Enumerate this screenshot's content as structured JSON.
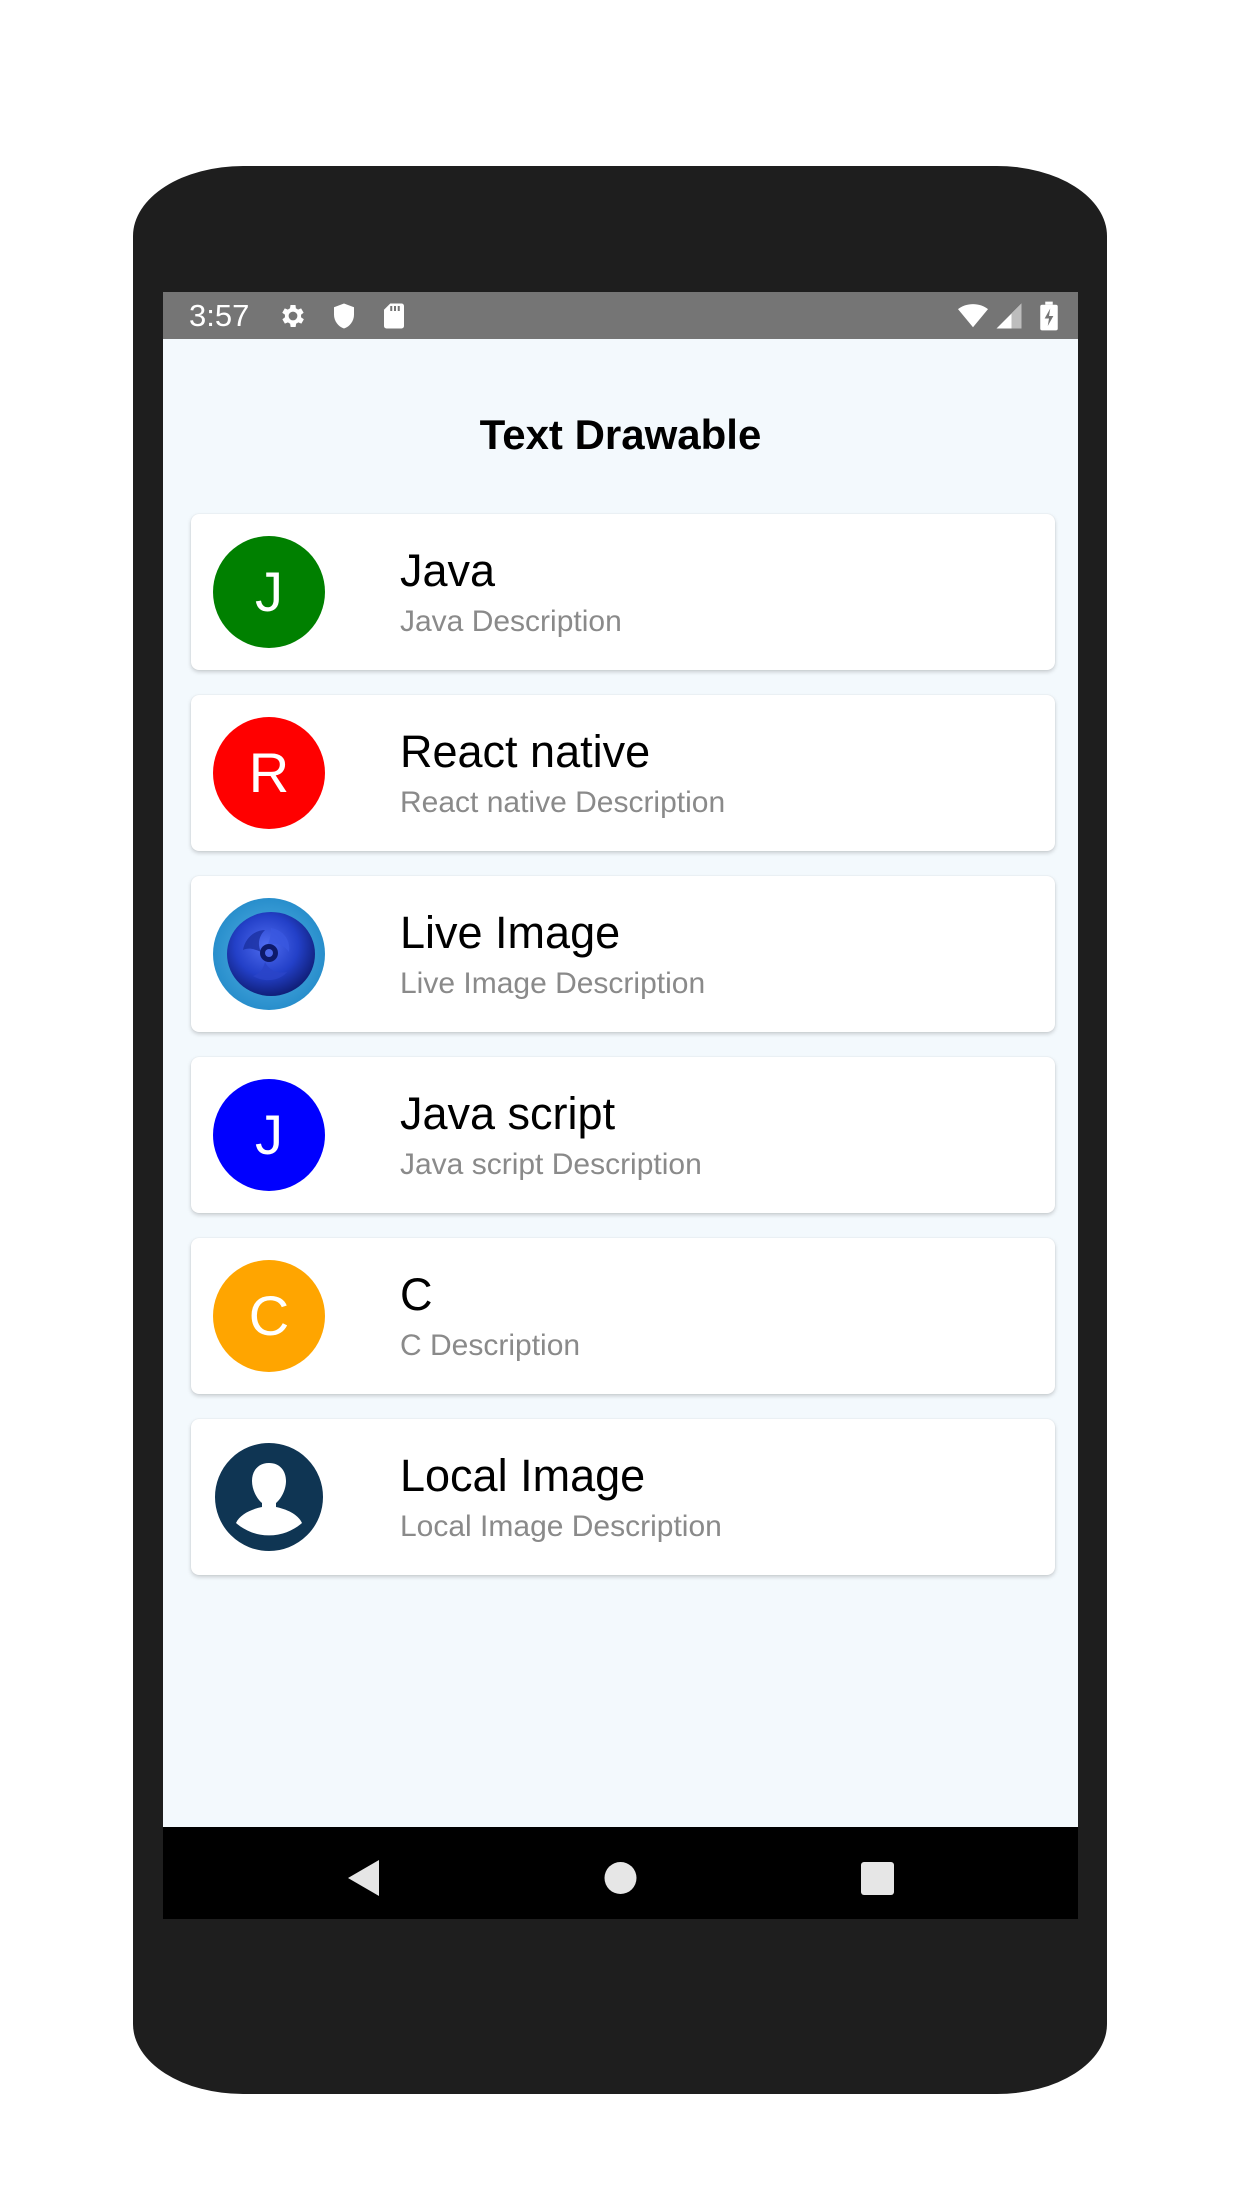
{
  "status_bar": {
    "time": "3:57",
    "left_icons": [
      "gear-icon",
      "shield-icon",
      "sd-card-icon"
    ],
    "right_icons": [
      "wifi-icon",
      "cell-signal-icon",
      "battery-charging-icon"
    ],
    "background": "#757575"
  },
  "app": {
    "title": "Text Drawable"
  },
  "list": {
    "items": [
      {
        "initial": "J",
        "title": "Java",
        "description": "Java Description",
        "avatar_color": "#008000",
        "avatar_type": "letter"
      },
      {
        "initial": "R",
        "title": "React native",
        "description": "React native Description",
        "avatar_color": "#ff0000",
        "avatar_type": "letter"
      },
      {
        "initial": "",
        "title": "Live Image",
        "description": "Live Image Description",
        "avatar_color": "#1a3fd0",
        "avatar_type": "image-blue-rose"
      },
      {
        "initial": "J",
        "title": "Java script",
        "description": "Java script Description",
        "avatar_color": "#0000ff",
        "avatar_type": "letter"
      },
      {
        "initial": "C",
        "title": "C",
        "description": "C Description",
        "avatar_color": "#ffa500",
        "avatar_type": "letter"
      },
      {
        "initial": "",
        "title": "Local Image",
        "description": "Local Image Description",
        "avatar_color": "#0f3553",
        "avatar_type": "user-silhouette"
      }
    ]
  },
  "nav_bar": {
    "buttons": [
      "back-icon",
      "home-icon",
      "recents-icon"
    ]
  },
  "colors": {
    "screen_background": "#f3f9fd",
    "phone_body": "#1e1e1e",
    "description_text": "#8a8a8a"
  }
}
